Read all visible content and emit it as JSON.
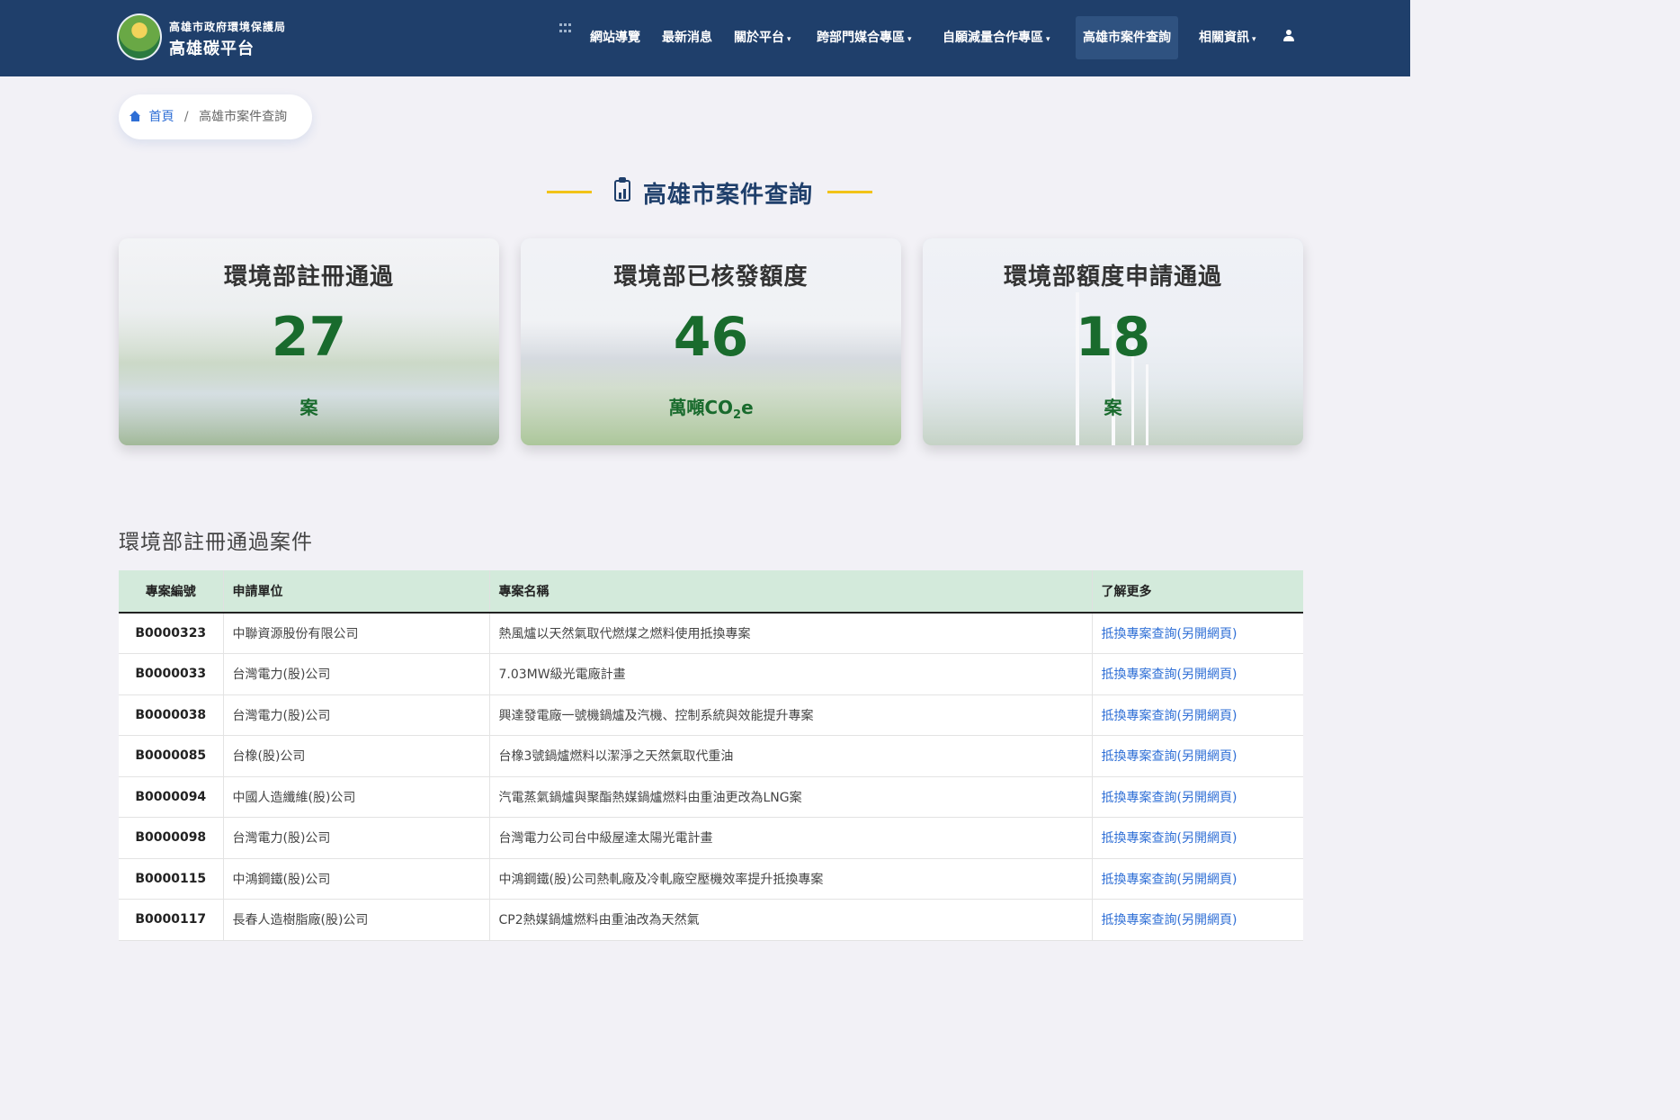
{
  "header": {
    "agency": "高雄市政府環境保護局",
    "platform": "高雄碳平台",
    "nav": [
      {
        "label": "網站導覽",
        "caret": ""
      },
      {
        "label": "最新消息",
        "caret": ""
      },
      {
        "label": "關於平台",
        "caret": "▾"
      },
      {
        "label": "跨部門媒合專區",
        "caret": "▾"
      },
      {
        "label": "自願減量合作專區",
        "caret": "▾"
      },
      {
        "label": "高雄市案件查詢",
        "caret": "",
        "active": true
      },
      {
        "label": "相關資訊",
        "caret": "▾"
      }
    ]
  },
  "breadcrumb": {
    "home": "首頁",
    "separator": "/",
    "current": "高雄市案件查詢"
  },
  "page_title": "高雄市案件查詢",
  "stats": [
    {
      "label": "環境部註冊通過",
      "value": "27",
      "unit": "案"
    },
    {
      "label": "環境部已核發額度",
      "value": "46",
      "unit_main": "萬噸CO",
      "unit_sub": "2",
      "unit_tail": "e"
    },
    {
      "label": "環境部額度申請通過",
      "value": "18",
      "unit": "案"
    }
  ],
  "table": {
    "heading": "環境部註冊通過案件",
    "columns": [
      "專案編號",
      "申請單位",
      "專案名稱",
      "了解更多"
    ],
    "rows": [
      {
        "id": "B0000323",
        "applicant": "中聯資源股份有限公司",
        "project": "熱風爐以天然氣取代燃煤之燃料使用抵換專案",
        "link": "抵換專案查詢(另開網頁)"
      },
      {
        "id": "B0000033",
        "applicant": "台灣電力(股)公司",
        "project": "7.03MW級光電廠計畫",
        "link": "抵換專案查詢(另開網頁)"
      },
      {
        "id": "B0000038",
        "applicant": "台灣電力(股)公司",
        "project": "興達發電廠一號機鍋爐及汽機、控制系統與效能提升專案",
        "link": "抵換專案查詢(另開網頁)"
      },
      {
        "id": "B0000085",
        "applicant": "台橡(股)公司",
        "project": "台橡3號鍋爐燃料以潔淨之天然氣取代重油",
        "link": "抵換專案查詢(另開網頁)"
      },
      {
        "id": "B0000094",
        "applicant": "中國人造纖維(股)公司",
        "project": "汽電蒸氣鍋爐與聚酯熱媒鍋爐燃料由重油更改為LNG案",
        "link": "抵換專案查詢(另開網頁)"
      },
      {
        "id": "B0000098",
        "applicant": "台灣電力(股)公司",
        "project": "台灣電力公司台中級屋達太陽光電計畫",
        "link": "抵換專案查詢(另開網頁)"
      },
      {
        "id": "B0000115",
        "applicant": "中鴻鋼鐵(股)公司",
        "project": "中鴻鋼鐵(股)公司熱軋廠及冷軋廠空壓機效率提升抵換專案",
        "link": "抵換專案查詢(另開網頁)"
      },
      {
        "id": "B0000117",
        "applicant": "長春人造樹脂廠(股)公司",
        "project": "CP2熱媒鍋爐燃料由重油改為天然氣",
        "link": "抵換專案查詢(另開網頁)"
      }
    ]
  },
  "colors": {
    "header_bg": "#1f3f6b",
    "stat_green": "#196b2d",
    "accent_yellow": "#f2c318",
    "link_blue": "#2f6fd6",
    "table_head_bg": "#d3eadb"
  }
}
